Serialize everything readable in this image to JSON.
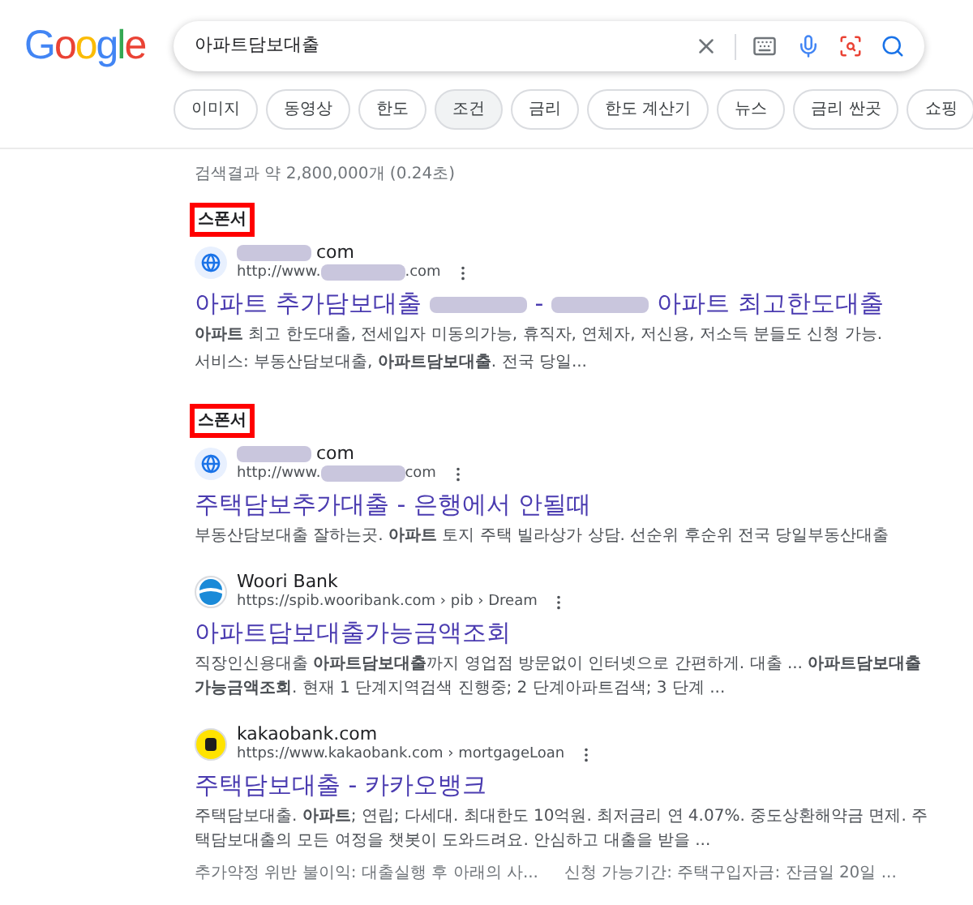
{
  "logo": "Google",
  "search": {
    "value": "아파트담보대출"
  },
  "chips": [
    {
      "label": "이미지",
      "selected": false
    },
    {
      "label": "동영상",
      "selected": false
    },
    {
      "label": "한도",
      "selected": false
    },
    {
      "label": "조건",
      "selected": true
    },
    {
      "label": "금리",
      "selected": false
    },
    {
      "label": "한도 계산기",
      "selected": false
    },
    {
      "label": "뉴스",
      "selected": false
    },
    {
      "label": "금리 싼곳",
      "selected": false
    },
    {
      "label": "쇼핑",
      "selected": false
    }
  ],
  "result_stats": "검색결과 약 2,800,000개 (0.24초)",
  "results": [
    {
      "sponsor_label": "스폰서",
      "favicon": {
        "kind": "globe"
      },
      "site_name": [
        {
          "kind": "redacted"
        },
        {
          "kind": "text",
          "text": "com"
        }
      ],
      "url": [
        {
          "kind": "text",
          "text": "http://www."
        },
        {
          "kind": "redacted"
        },
        {
          "kind": "text",
          "text": ".com"
        }
      ],
      "title": [
        {
          "kind": "text",
          "text": "아파트 추가담보대출"
        },
        {
          "kind": "redacted"
        },
        {
          "kind": "text",
          "text": "-"
        },
        {
          "kind": "redacted"
        },
        {
          "kind": "text",
          "text": "아파트 최고한도대출"
        }
      ],
      "snippet": [
        "**아파트** 최고 한도대출, 전세입자 미동의가능, 휴직자, 연체자, 저신용, 저소득 분들도 신청 가능.",
        "서비스: 부동산담보대출, **아파트담보대출**. 전국 당일..."
      ]
    },
    {
      "sponsor_label": "스폰서",
      "favicon": {
        "kind": "globe"
      },
      "site_name": [
        {
          "kind": "redacted"
        },
        {
          "kind": "text",
          "text": "com"
        }
      ],
      "url": [
        {
          "kind": "text",
          "text": "http://www."
        },
        {
          "kind": "redacted"
        },
        {
          "kind": "text",
          "text": "com"
        }
      ],
      "title": [
        {
          "kind": "text",
          "text": "주택담보추가대출 - 은행에서 안될때"
        }
      ],
      "snippet": [
        "부동산담보대출 잘하는곳. **아파트** 토지 주택 빌라상가 상담. 선순위 후순위 전국 당일부동산대출"
      ]
    },
    {
      "favicon": {
        "kind": "wave"
      },
      "site_name": [
        {
          "kind": "text",
          "text": "Woori Bank"
        }
      ],
      "url": [
        {
          "kind": "text",
          "text": "https://spib.wooribank.com › pib › Dream"
        }
      ],
      "title": [
        {
          "kind": "text",
          "text": "아파트담보대출가능금액조회"
        }
      ],
      "snippet": [
        "직장인신용대출 **아파트담보대출**까지 영업점 방문없이 인터넷으로 간편하게. 대출 ... **아파트담보대출가능금액조회**. 현재 1 단계지역검색 진행중; 2 단계아파트검색; 3 단계 ..."
      ]
    },
    {
      "favicon": {
        "kind": "square"
      },
      "site_name": [
        {
          "kind": "text",
          "text": "kakaobank.com"
        }
      ],
      "url": [
        {
          "kind": "text",
          "text": "https://www.kakaobank.com › mortgageLoan"
        }
      ],
      "title": [
        {
          "kind": "text",
          "text": "주택담보대출 - 카카오뱅크"
        }
      ],
      "snippet": [
        "주택담보대출. **아파트**; 연립; 다세대. 최대한도 10억원. 최저금리 연 4.07%. 중도상환해약금 면제. 주택담보대출의 모든 여정을 챗봇이 도와드려요. 안심하고 대출을 받을 ..."
      ],
      "sitelinks": [
        "추가약정 위반 불이익: 대출실행 후 아래의 사...",
        "신청 가능기간: 주택구입자금: 잔금일 20일 ..."
      ]
    }
  ]
}
